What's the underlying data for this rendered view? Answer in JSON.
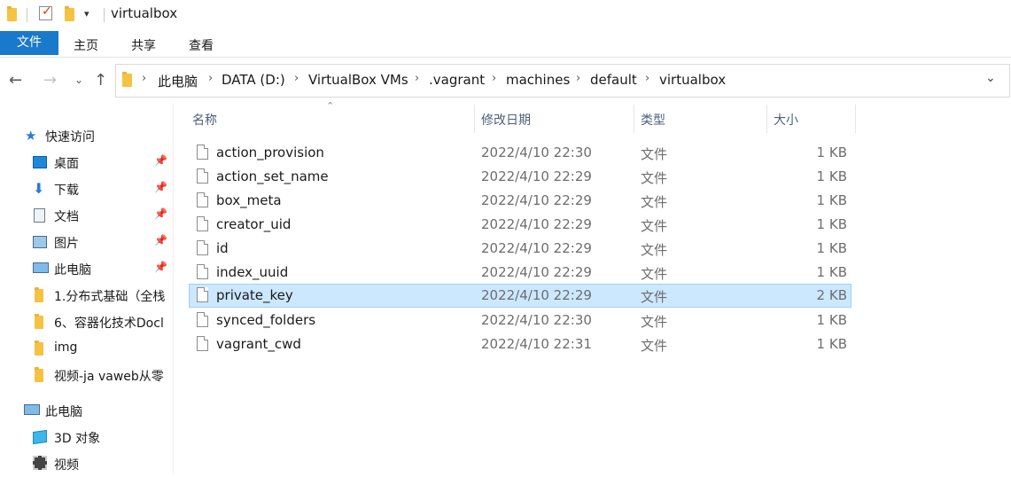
{
  "window": {
    "title": "virtualbox"
  },
  "ribbon": {
    "tabs": [
      "文件",
      "主页",
      "共享",
      "查看"
    ]
  },
  "address": {
    "crumbs": [
      "此电脑",
      "DATA (D:)",
      "VirtualBox VMs",
      ".vagrant",
      "machines",
      "default",
      "virtualbox"
    ]
  },
  "nav": {
    "quick_access": "快速访问",
    "items": [
      "桌面",
      "下载",
      "文档",
      "图片",
      "此电脑",
      "1.分布式基础（全栈",
      "6、容器化技术Docl",
      "img",
      "视频-ja vaweb从零"
    ],
    "this_pc": "此电脑",
    "pc_items": [
      "3D 对象",
      "视频"
    ]
  },
  "columns": {
    "name": "名称",
    "date": "修改日期",
    "type": "类型",
    "size": "大小"
  },
  "files": [
    {
      "name": "action_provision",
      "date": "2022/4/10 22:30",
      "type": "文件",
      "size": "1 KB"
    },
    {
      "name": "action_set_name",
      "date": "2022/4/10 22:29",
      "type": "文件",
      "size": "1 KB"
    },
    {
      "name": "box_meta",
      "date": "2022/4/10 22:29",
      "type": "文件",
      "size": "1 KB"
    },
    {
      "name": "creator_uid",
      "date": "2022/4/10 22:29",
      "type": "文件",
      "size": "1 KB"
    },
    {
      "name": "id",
      "date": "2022/4/10 22:29",
      "type": "文件",
      "size": "1 KB"
    },
    {
      "name": "index_uuid",
      "date": "2022/4/10 22:29",
      "type": "文件",
      "size": "1 KB"
    },
    {
      "name": "private_key",
      "date": "2022/4/10 22:29",
      "type": "文件",
      "size": "2 KB"
    },
    {
      "name": "synced_folders",
      "date": "2022/4/10 22:30",
      "type": "文件",
      "size": "1 KB"
    },
    {
      "name": "vagrant_cwd",
      "date": "2022/4/10 22:31",
      "type": "文件",
      "size": "1 KB"
    }
  ],
  "selected_file": "private_key",
  "colors": {
    "accent": "#1979ca",
    "selection": "#cce8ff",
    "selection_border": "#99d1ff"
  }
}
